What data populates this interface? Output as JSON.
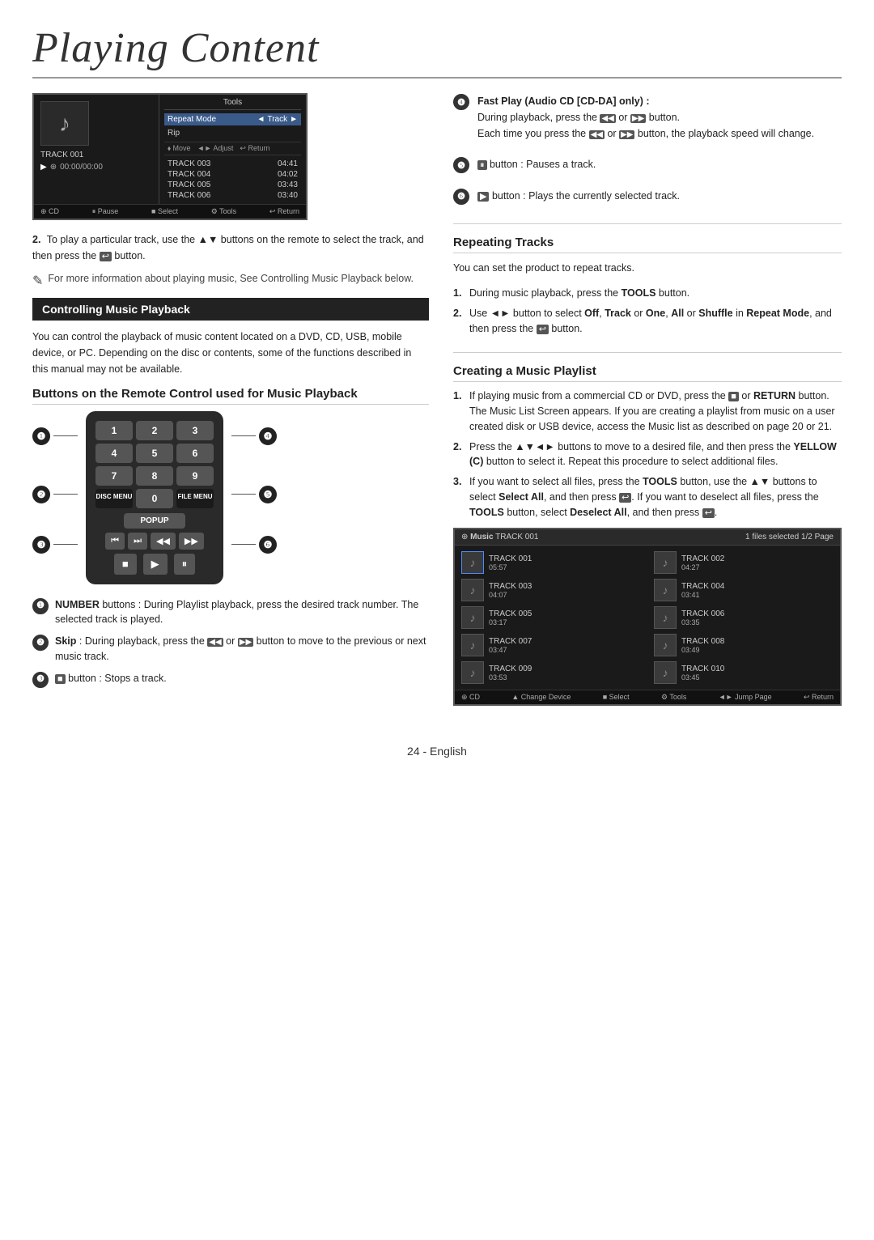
{
  "page": {
    "title": "Playing Content",
    "page_number": "24 - English"
  },
  "screen": {
    "track_label": "TRACK 001",
    "tools_header": "Tools",
    "repeat_mode_label": "Repeat Mode",
    "repeat_mode_value": "Track",
    "rip_label": "Rip",
    "nav_hints": [
      "Move",
      "Adjust",
      "Return"
    ],
    "tracks": [
      {
        "name": "TRACK 003",
        "time": "04:41"
      },
      {
        "name": "TRACK 004",
        "time": "04:02"
      },
      {
        "name": "TRACK 005",
        "time": "03:43"
      },
      {
        "name": "TRACK 006",
        "time": "03:40"
      }
    ],
    "time_display": "00:00/00:00",
    "footer_items": [
      "CD",
      "Pause",
      "Select",
      "Tools",
      "Return"
    ]
  },
  "steps_left": [
    {
      "num": "2.",
      "text": "To play a particular track, use the ▲▼ buttons on the remote to select the track, and then press the  button."
    }
  ],
  "note_text": "For more information about playing music, See Controlling Music Playback below.",
  "controlling_section": {
    "header": "Controlling Music Playback",
    "body": "You can control the playback of music content located on a DVD, CD, USB, mobile device, or PC. Depending on the disc or contents, some of the functions described in this manual may not be available."
  },
  "remote_section": {
    "title": "Buttons on the Remote Control used for Music Playback",
    "buttons": {
      "numbers": [
        "1",
        "2",
        "3",
        "4",
        "5",
        "6",
        "7",
        "8",
        "9"
      ],
      "zero": "0",
      "popup": "POPUP",
      "menu": "DISC MENU",
      "file_menu": "FILE MENU"
    },
    "labels": {
      "1": "❶",
      "2": "❷",
      "3": "❸",
      "4": "❹",
      "5": "❺",
      "6": "❻"
    }
  },
  "remote_descriptions": [
    {
      "num": "❶",
      "title": "NUMBER",
      "text": "buttons : During Playlist playback, press the desired track number. The selected track is played."
    },
    {
      "num": "❷",
      "title": "Skip",
      "text": ": During playback, press the  or  button to move to the previous or next music track."
    },
    {
      "num": "❸",
      "text": " button : Stops a track."
    }
  ],
  "right_col": {
    "fast_play": {
      "title": "Fast Play (Audio CD [CD-DA] only) :",
      "text1": "During playback, press the  or  button.",
      "text2": "Each time you press the  or  button, the playback speed will change."
    },
    "pause_btn": {
      "num": "❺",
      "text": " button : Pauses a track."
    },
    "play_btn": {
      "num": "❻",
      "text": " button : Plays the currently selected track."
    },
    "repeating_tracks": {
      "title": "Repeating Tracks",
      "intro": "You can set the product to repeat tracks.",
      "steps": [
        "During music playback, press the TOOLS button.",
        "Use ◄► button to select Off, Track or One, All or Shuffle in Repeat Mode, and then press the  button."
      ]
    },
    "creating_playlist": {
      "title": "Creating a Music Playlist",
      "steps": [
        "If playing music from a commercial CD or DVD, press the  or RETURN button. The Music List Screen appears. If you are creating a playlist from music on a user created disk or USB device, access the Music list as described on page 20 or 21.",
        "Press the ▲▼◄► buttons to move to a desired file, and then press the YELLOW (C) button to select it. Repeat this procedure to select additional files.",
        "If you want to select all files, press the TOOLS button, use the ▲▼ buttons to select Select All, and then press . If you want to deselect all files, press the TOOLS button, select Deselect All, and then press ."
      ]
    }
  },
  "playlist_screen": {
    "header_left": "Music  TRACK 001",
    "header_right": "1 files selected   1/2 Page",
    "tracks": [
      {
        "name": "TRACK 001",
        "time": "05:57",
        "selected": true
      },
      {
        "name": "TRACK 002",
        "time": "04:27",
        "selected": false
      },
      {
        "name": "TRACK 003",
        "time": "04:07",
        "selected": false
      },
      {
        "name": "TRACK 004",
        "time": "03:41",
        "selected": false
      },
      {
        "name": "TRACK 005",
        "time": "03:17",
        "selected": false
      },
      {
        "name": "TRACK 006",
        "time": "03:35",
        "selected": false
      },
      {
        "name": "TRACK 007",
        "time": "03:47",
        "selected": false
      },
      {
        "name": "TRACK 008",
        "time": "03:49",
        "selected": false
      },
      {
        "name": "TRACK 009",
        "time": "03:53",
        "selected": false
      },
      {
        "name": "TRACK 010",
        "time": "03:45",
        "selected": false
      }
    ],
    "footer": [
      "CD",
      "Change Device",
      "Select",
      "Tools",
      "Jump Page",
      "Return"
    ]
  }
}
